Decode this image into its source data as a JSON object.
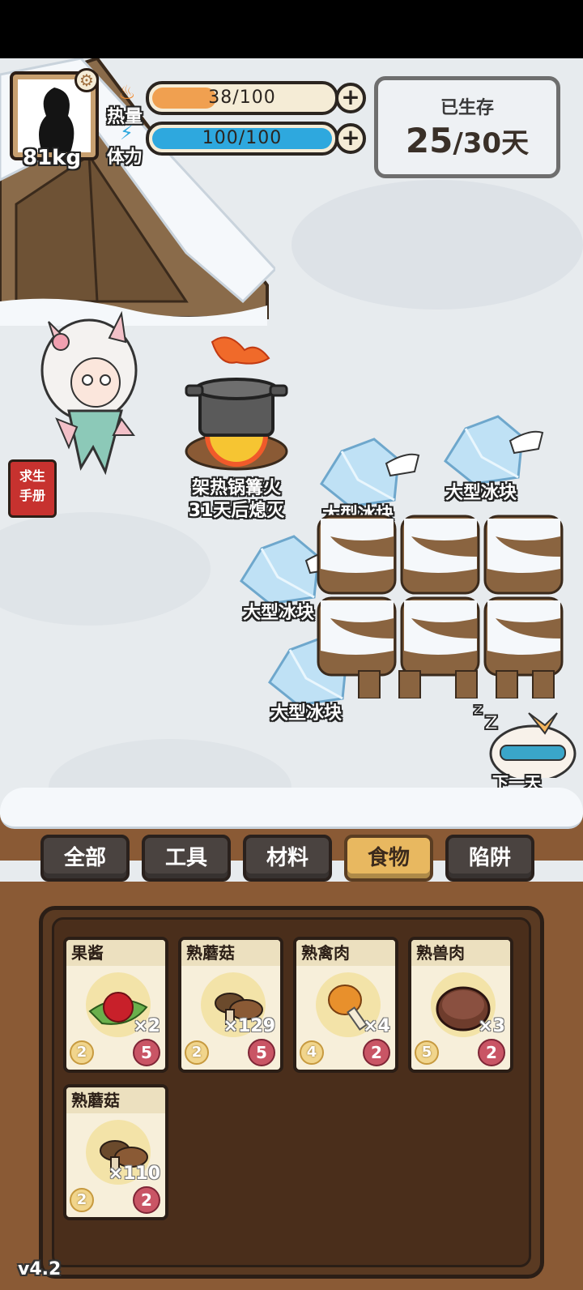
{
  "player": {
    "weight": "81kg"
  },
  "stats": {
    "heat": {
      "label": "热量",
      "value": "38/100",
      "fraction": 0.38,
      "color": "#f0a050"
    },
    "stamina": {
      "label": "体力",
      "value": "100/100",
      "fraction": 1.0,
      "color": "#2ea8de"
    }
  },
  "survival": {
    "label": "已生存",
    "days": "25",
    "total": "/30天"
  },
  "world": {
    "campfire": {
      "name": "架热锅篝火",
      "status": "31天后熄灭"
    },
    "ice_label": "大型冰块",
    "next_day": "下一天"
  },
  "handbook": {
    "line1": "求生",
    "line2": "手册"
  },
  "tabs": [
    {
      "label": "全部",
      "active": false
    },
    {
      "label": "工具",
      "active": false
    },
    {
      "label": "材料",
      "active": false
    },
    {
      "label": "食物",
      "active": true
    },
    {
      "label": "陷阱",
      "active": false
    }
  ],
  "inventory": [
    {
      "name": "果酱",
      "count": "×2",
      "stat1": "2",
      "stat2": "5",
      "icon": "jam-icon"
    },
    {
      "name": "熟蘑菇",
      "count": "×129",
      "stat1": "2",
      "stat2": "5",
      "icon": "mushroom-icon"
    },
    {
      "name": "熟禽肉",
      "count": "×4",
      "stat1": "4",
      "stat2": "2",
      "icon": "drumstick-icon"
    },
    {
      "name": "熟兽肉",
      "count": "×3",
      "stat1": "5",
      "stat2": "2",
      "icon": "meat-icon"
    },
    {
      "name": "熟蘑菇",
      "count": "×110",
      "stat1": "2",
      "stat2": "2",
      "icon": "mushroom-icon"
    }
  ],
  "version": "v4.2"
}
